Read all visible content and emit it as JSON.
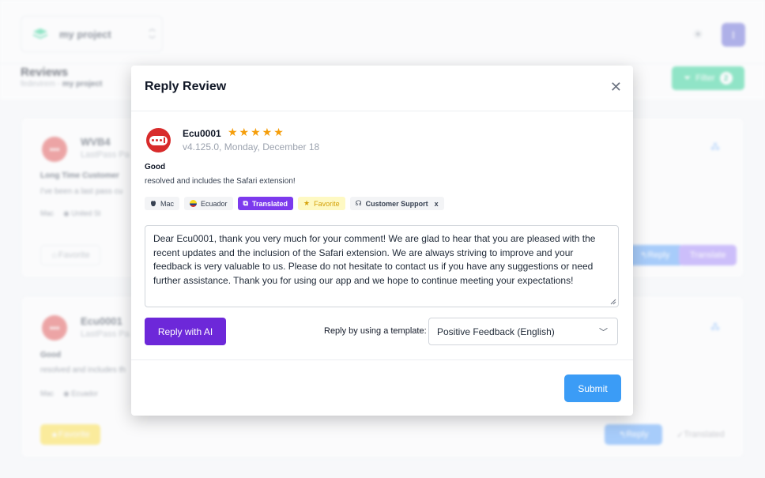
{
  "background": {
    "project_name": "my project",
    "page_title": "Reviews",
    "breadcrumb_user": "fedevirem",
    "breadcrumb_sep": " - ",
    "breadcrumb_project": "my project",
    "filter_label": "Filter",
    "filter_count": "2",
    "cards": [
      {
        "name": "WVB4",
        "sub": "LastPass Pa",
        "title": "Long Time Customer",
        "body": "I've been a last pass cu",
        "tag_os": "Mac",
        "tag_country": "United St",
        "favorite": "Favorite",
        "reply": "Reply",
        "translate": "Translate"
      },
      {
        "name": "Ecu0001",
        "sub": "LastPass Pa",
        "title": "Good",
        "body": "resolved and includes th",
        "tag_os": "Mac",
        "tag_country": "Ecuador",
        "favorite": "Favorite",
        "reply": "Reply",
        "translate": "Translated"
      }
    ]
  },
  "modal": {
    "title": "Reply Review",
    "review": {
      "author": "Ecu0001",
      "rating": 5,
      "stars": "★★★★★",
      "version": "v4.125.0,",
      "date": "Monday, December 18",
      "title": "Good",
      "body": "resolved and includes the Safari extension!",
      "tags": {
        "os": "Mac",
        "country": "Ecuador",
        "translated": "Translated",
        "favorite": "Favorite",
        "support": "Customer Support",
        "support_remove": "x"
      }
    },
    "reply_text": "Dear Ecu0001, thank you very much for your comment! We are glad to hear that you are pleased with the recent updates and the inclusion of the Safari extension. We are always striving to improve and your feedback is very valuable to us. Please do not hesitate to contact us if you have any suggestions or need further assistance. Thank you for using our app and we hope to continue meeting your expectations!",
    "ai_button": "Reply with AI",
    "template_label": "Reply by using a template:",
    "template_selected": "Positive Feedback (English)",
    "submit": "Submit"
  },
  "colors": {
    "primary_purple": "#6d28d9",
    "submit_blue": "#3b9cf6",
    "star": "#f59e0b"
  }
}
